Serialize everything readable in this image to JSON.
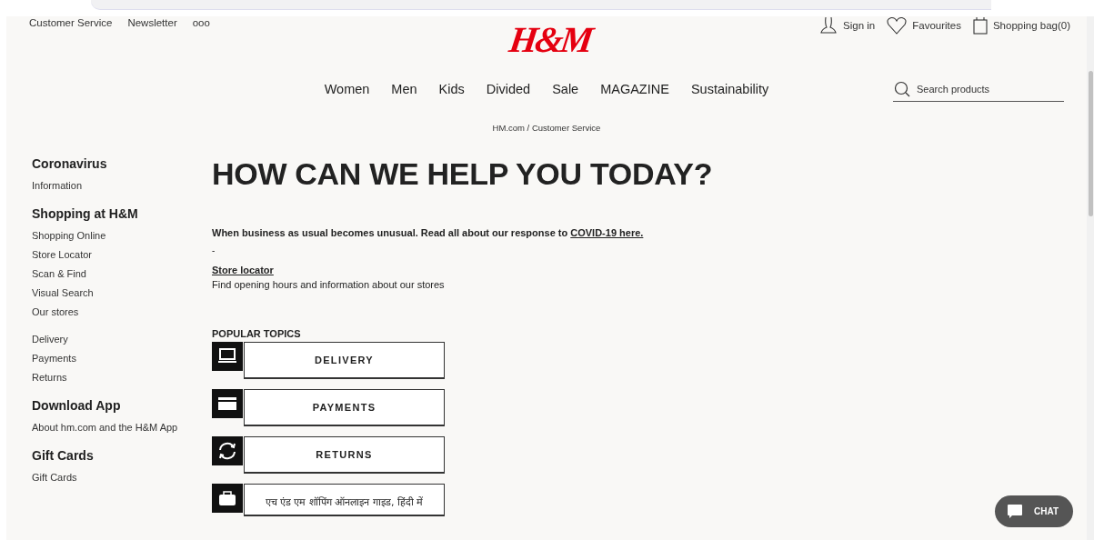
{
  "top_links": [
    "Customer Service",
    "Newsletter",
    "ooo"
  ],
  "account_links": [
    {
      "kind": "person",
      "label": "Sign in"
    },
    {
      "kind": "heart",
      "label": "Favourites"
    },
    {
      "kind": "bag",
      "label": "Shopping bag(0)"
    }
  ],
  "logo": "H&M",
  "nav": [
    "Women",
    "Men",
    "Kids",
    "Divided",
    "Sale",
    "MAGAZINE",
    "Sustainability"
  ],
  "search": {
    "placeholder": "Search products"
  },
  "breadcrumb": "HM.com / Customer Service",
  "sidebar": {
    "sections": [
      {
        "heading": "Coronavirus",
        "items": [
          "Information"
        ]
      },
      {
        "heading": "Shopping at H&M",
        "items": [
          "Shopping Online",
          "Store Locator",
          "Scan & Find",
          "Visual Search",
          "Our stores"
        ]
      },
      {
        "items": [
          "Delivery",
          "Payments",
          "Returns"
        ]
      },
      {
        "heading": "Download App",
        "items": [
          "About hm.com and the H&M App"
        ]
      },
      {
        "heading": "Gift Cards",
        "items": [
          "Gift Cards"
        ]
      }
    ]
  },
  "title": "HOW CAN WE HELP YOU TODAY?",
  "notice": {
    "text": "When business as usual becomes unusual. Read all about our response to",
    "link": "COVID-19 here."
  },
  "dash": "-",
  "store_locator": {
    "link": "Store locator",
    "text": "Find opening hours and information about our stores"
  },
  "popular_topics": {
    "title": "POPULAR TOPICS",
    "items": [
      {
        "kind": "delivery",
        "label": "DELIVERY"
      },
      {
        "kind": "card",
        "label": "PAYMENTS"
      },
      {
        "kind": "returns",
        "label": "RETURNS"
      },
      {
        "kind": "bag",
        "label": "एच एंड एम शॉपिंग ऑनलाइन गाइड, हिंदी में"
      }
    ]
  },
  "chat": {
    "label": "CHAT"
  }
}
